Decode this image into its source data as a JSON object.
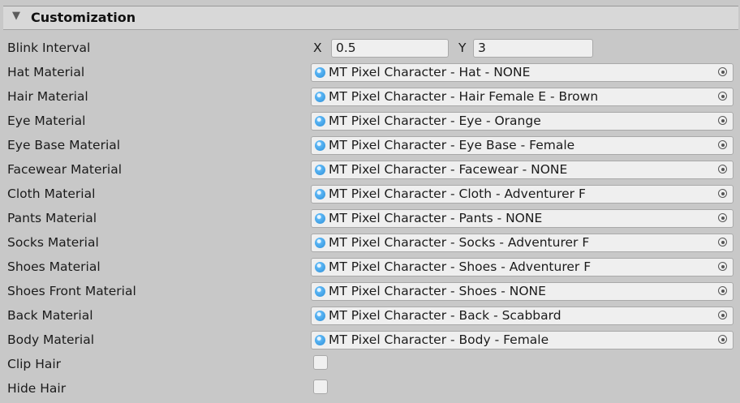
{
  "section": {
    "title": "Customization",
    "expanded": true
  },
  "blink_interval": {
    "label": "Blink Interval",
    "x_label": "X",
    "x_value": "0.5",
    "y_label": "Y",
    "y_value": "3"
  },
  "materials": [
    {
      "label": "Hat Material",
      "value": "MT Pixel Character - Hat - NONE"
    },
    {
      "label": "Hair Material",
      "value": "MT Pixel Character - Hair Female E - Brown"
    },
    {
      "label": "Eye Material",
      "value": "MT Pixel Character - Eye - Orange"
    },
    {
      "label": "Eye Base Material",
      "value": "MT Pixel Character - Eye Base - Female"
    },
    {
      "label": "Facewear Material",
      "value": "MT Pixel Character - Facewear - NONE"
    },
    {
      "label": "Cloth Material",
      "value": "MT Pixel Character - Cloth - Adventurer F"
    },
    {
      "label": "Pants Material",
      "value": "MT Pixel Character - Pants - NONE"
    },
    {
      "label": "Socks Material",
      "value": "MT Pixel Character - Socks - Adventurer F"
    },
    {
      "label": "Shoes Material",
      "value": "MT Pixel Character - Shoes - Adventurer F"
    },
    {
      "label": "Shoes Front Material",
      "value": "MT Pixel Character - Shoes - NONE"
    },
    {
      "label": "Back Material",
      "value": "MT Pixel Character - Back - Scabbard"
    },
    {
      "label": "Body Material",
      "value": "MT Pixel Character - Body - Female"
    }
  ],
  "toggles": [
    {
      "label": "Clip Hair",
      "checked": false
    },
    {
      "label": "Hide Hair",
      "checked": false
    }
  ],
  "icons": {
    "fold": "triangle-down-icon",
    "asset": "material-asset-icon",
    "picker": "object-picker-icon"
  },
  "colors": {
    "background": "#c8c8c8",
    "header": "#d8d8d8",
    "field": "#efefef",
    "asset_icon": "#3fa3ee"
  }
}
